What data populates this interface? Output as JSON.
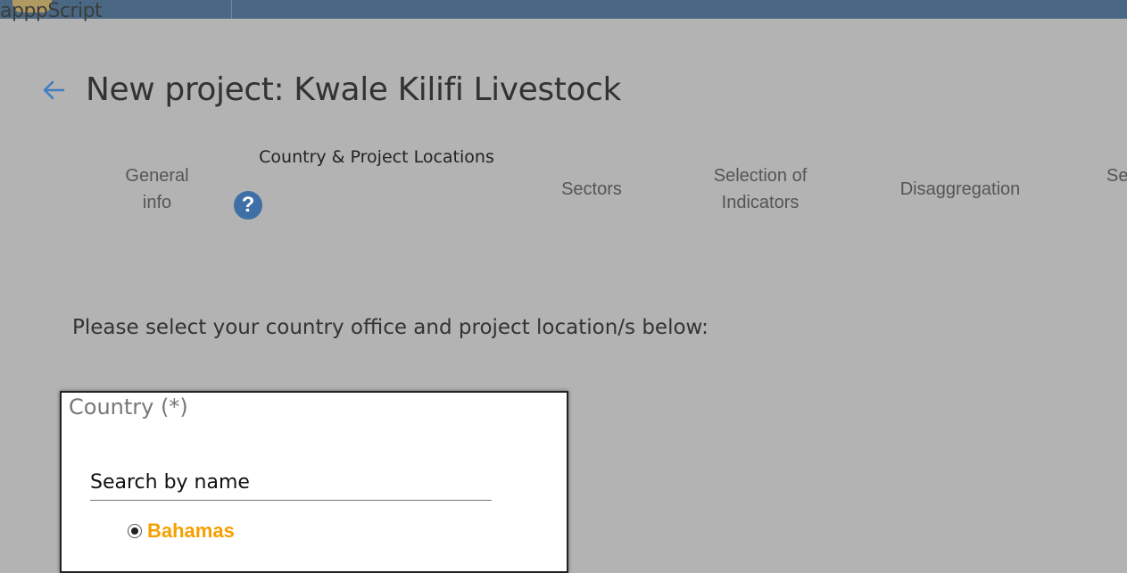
{
  "app": {
    "logo_label": "apppScript"
  },
  "header": {
    "back_icon": "arrow-left-icon",
    "title": "New project: Kwale Kilifi Livestock"
  },
  "stepper": {
    "steps": [
      {
        "label": "General info",
        "active": false
      },
      {
        "label": "Country & Project Locations",
        "active": true
      },
      {
        "label": "Sectors",
        "active": false
      },
      {
        "label": "Selection of Indicators",
        "active": false
      },
      {
        "label": "Disaggregation",
        "active": false
      },
      {
        "label": "Se",
        "active": false
      }
    ],
    "help_icon": "question-icon",
    "help_symbol": "?"
  },
  "main": {
    "instructions": "Please select your country office and project location/s below:"
  },
  "country_card": {
    "title": "Country (*)",
    "search_placeholder": "Search by name",
    "search_value": "",
    "options": [
      {
        "label": "Bahamas",
        "selected": true
      }
    ]
  },
  "colors": {
    "topbar": "#4a6884",
    "accent": "#3e6fa6",
    "selected_option": "#f5a000",
    "overlay_bg": "#b3b3b3"
  }
}
